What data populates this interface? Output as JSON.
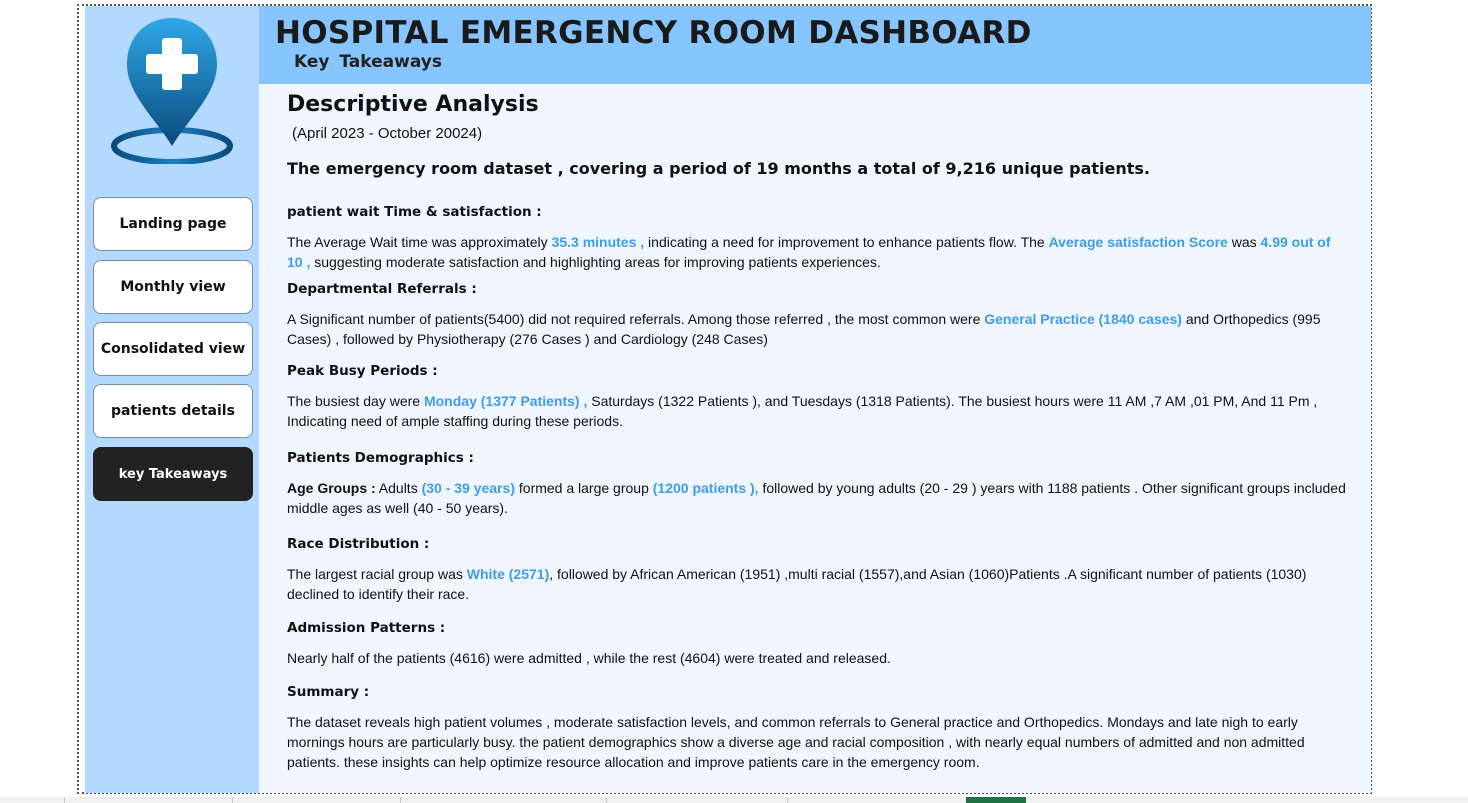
{
  "header": {
    "title": "HOSPITAL EMERGENCY ROOM DASHBOARD",
    "subtitle": "Key Takeaways"
  },
  "sidebar": {
    "logo_icon": "hospital-location-pin-icon",
    "items": [
      {
        "label": "Landing page",
        "active": false
      },
      {
        "label": "Monthly view",
        "active": false
      },
      {
        "label": "Consolidated view",
        "active": false
      },
      {
        "label": "patients details",
        "active": false
      },
      {
        "label": "key Takeaways",
        "active": true
      }
    ]
  },
  "content": {
    "heading": "Descriptive Analysis",
    "period": "(April 2023 - October 20024)",
    "lead": "The emergency room dataset , covering a period of 19 months a total of 9,216 unique patients.",
    "wait": {
      "heading": "patient wait Time  & satisfaction :",
      "t1": "The   Average Wait time was approximately ",
      "h1": "35.3 minutes ,",
      "t2": " indicating a need for improvement to enhance patients flow. The ",
      "h2": "Average satisfaction Score",
      "t3": " was ",
      "h3": "4.99 out of 10 ,",
      "t4": " suggesting moderate satisfaction and highlighting areas for improving patients experiences."
    },
    "referrals": {
      "heading": "Departmental Referrals :",
      "t1": "A Significant number of patients(5400) did not required referrals. Among those referred , the most common were ",
      "h1": "General Practice (1840 cases)",
      "t2": " and Orthopedics (995 Cases) , followed by Physiotherapy (276 Cases ) and Cardiology (248 Cases)"
    },
    "peak": {
      "heading": "Peak Busy Periods :",
      "t1": "The busiest day were ",
      "h1": "Monday (1377 Patients) ,",
      "t2": " Saturdays (1322 Patients ), and Tuesdays (1318 Patients). The busiest hours were 11 AM ,7 AM ,01 PM, And 11 Pm , Indicating  need of ample staffing during these periods."
    },
    "demographics": {
      "heading": "Patients Demographics :",
      "age_label": "Age Groups :",
      "t1": " Adults ",
      "h1": "(30 - 39 years)",
      "t2": " formed a large group ",
      "h2": "(1200 patients ),",
      "t3": " followed by young adults (20 - 29 ) years with 1188 patients . Other significant groups included middle ages as well (40 - 50 years)."
    },
    "race": {
      "heading": "Race  Distribution :",
      "t1": "The largest racial group was ",
      "h1": "White (2571)",
      "t2": ", followed by African American (1951) ,multi racial (1557),and Asian (1060)Patients .A significant number of patients (1030) declined to identify their race."
    },
    "admission": {
      "heading": "Admission Patterns :",
      "text": "Nearly half of the patients (4616) were admitted , while the rest (4604) were treated and released."
    },
    "summary": {
      "heading": "Summary :",
      "text": "The dataset reveals high patient volumes , moderate  satisfaction levels, and common referrals to General practice  and Orthopedics. Mondays and late  nigh to early mornings hours are particularly  busy. the patient demographics show a diverse age and racial composition , with nearly equal numbers of admitted and non admitted patients. these insights can help optimize resource allocation and improve patients care in the emergency room."
    }
  },
  "colors": {
    "sidebar_bg": "#b3d9ff",
    "header_bg": "#87c5ff",
    "content_bg": "#eff6ff",
    "highlight": "#3f9ce8",
    "active_button": "#222222"
  }
}
